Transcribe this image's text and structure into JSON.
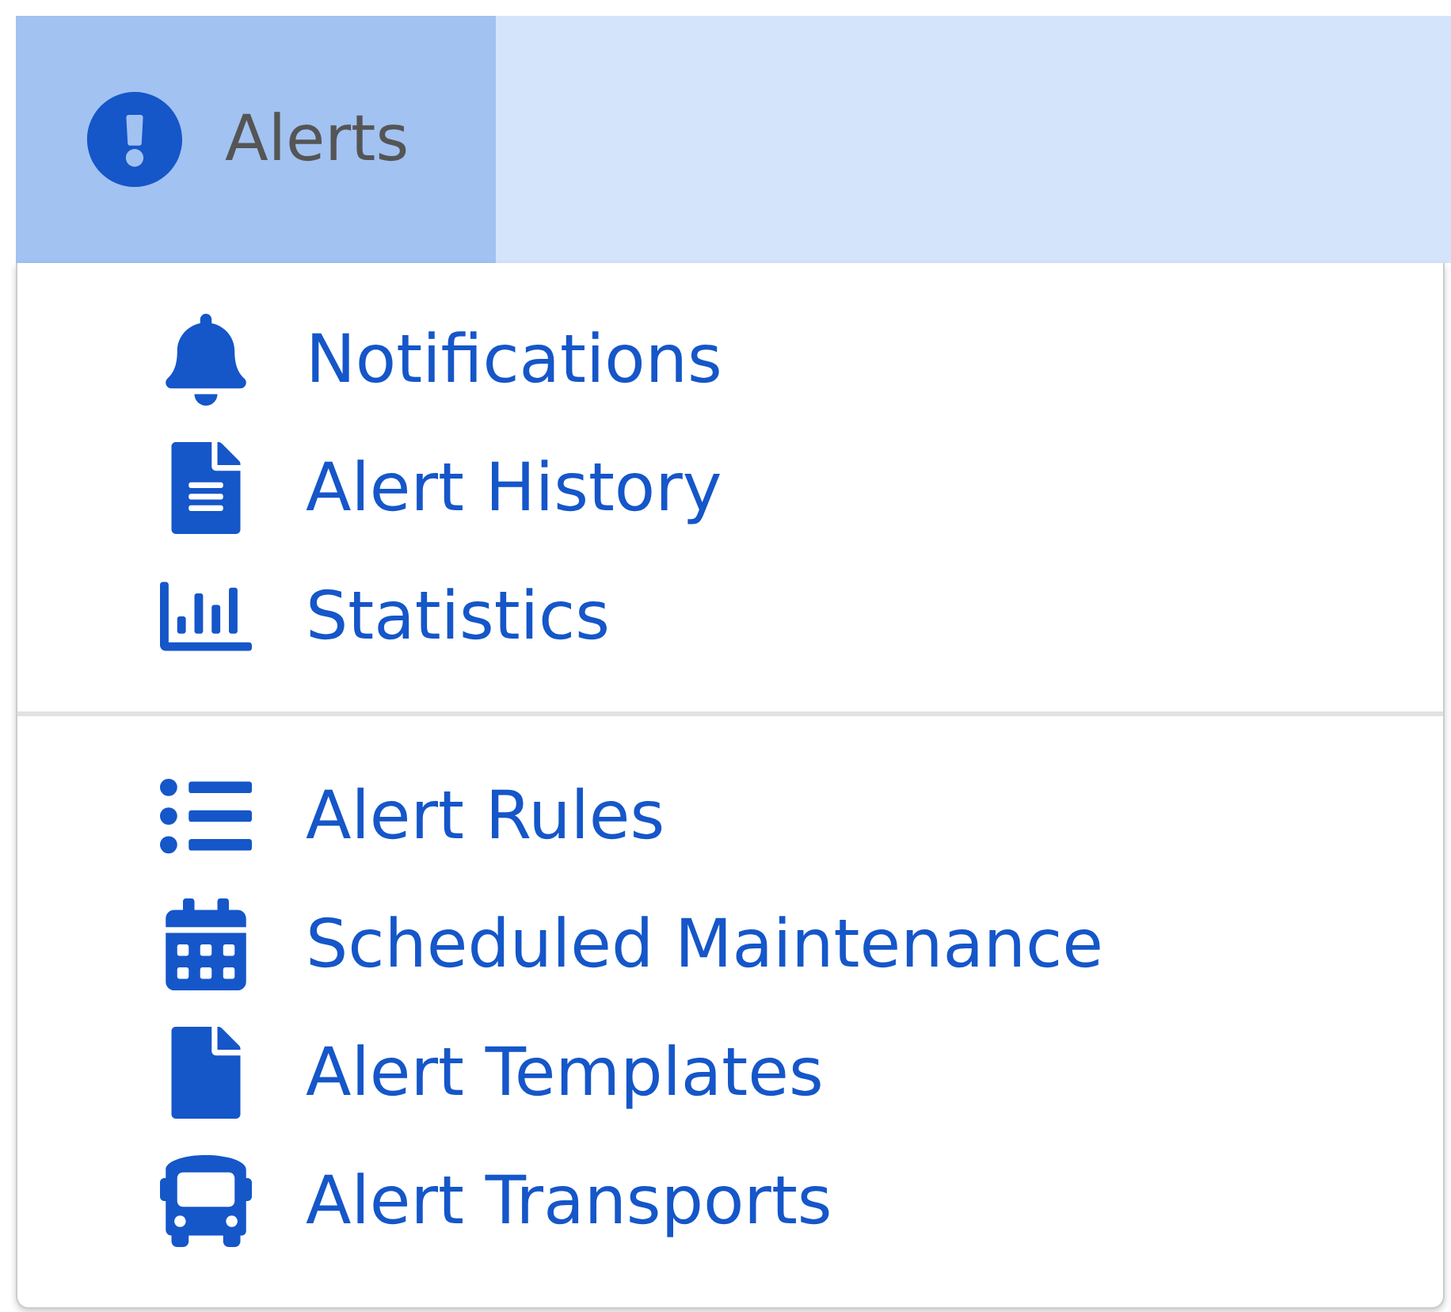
{
  "navbar": {
    "tab": {
      "label": "Alerts",
      "selected": true
    }
  },
  "menu": {
    "sections": [
      [
        {
          "kind": "bell",
          "label": "Notifications"
        },
        {
          "kind": "document",
          "label": "Alert History"
        },
        {
          "kind": "chart",
          "label": "Statistics"
        }
      ],
      [
        {
          "kind": "list",
          "label": "Alert Rules"
        },
        {
          "kind": "calendar",
          "label": "Scheduled Maintenance"
        },
        {
          "kind": "file",
          "label": "Alert Templates"
        },
        {
          "kind": "bus",
          "label": "Alert Transports"
        }
      ]
    ]
  }
}
